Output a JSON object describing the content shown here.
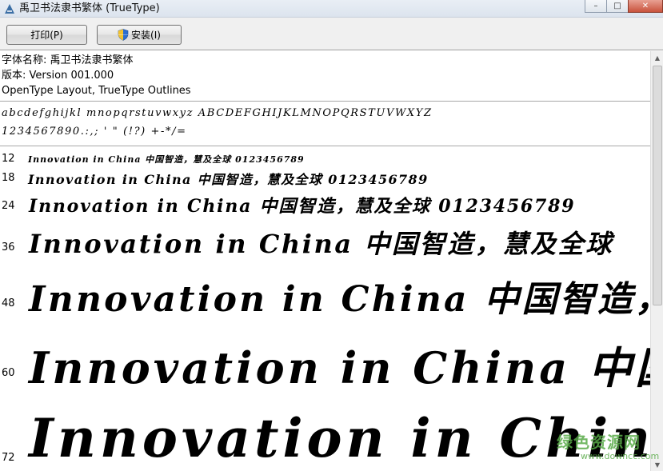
{
  "window": {
    "title": "禹卫书法隶书繁体 (TrueType)",
    "buttons": {
      "minimize": "–",
      "maximize": "□",
      "close": "✕"
    }
  },
  "toolbar": {
    "print_label": "打印(P)",
    "install_label": "安装(I)"
  },
  "font_info": {
    "name_line": "字体名称: 禹卫书法隶书繁体",
    "version_line": "版本: Version 001.000",
    "type_line": "OpenType Layout, TrueType Outlines"
  },
  "charset": {
    "line1": "abcdefghijkl mnopqrstuvwxyz ABCDEFGHIJKLMNOPQRSTUVWXYZ",
    "line2": "1234567890.:,;  '  \"  (!?)  +-*/="
  },
  "samples": [
    {
      "size": "12",
      "text": "Innovation in China 中国智造，慧及全球 0123456789"
    },
    {
      "size": "18",
      "text": "Innovation in China 中国智造，慧及全球 0123456789"
    },
    {
      "size": "24",
      "text": "Innovation in China 中国智造，慧及全球 0123456789"
    },
    {
      "size": "36",
      "text": "Innovation in China 中国智造，慧及全球"
    },
    {
      "size": "48",
      "text": "Innovation in China 中国智造，"
    },
    {
      "size": "60",
      "text": "Innovation in China 中国"
    },
    {
      "size": "72",
      "text": "Innovation in China"
    }
  ],
  "watermark": {
    "main": "绿色资源网",
    "sub": "www.downcc.com"
  },
  "colors": {
    "accent_green": "#58aa48",
    "toolbar_bg": "#f0f0f0"
  },
  "icons": {
    "app": "font-file-icon",
    "install": "uac-shield-icon"
  }
}
